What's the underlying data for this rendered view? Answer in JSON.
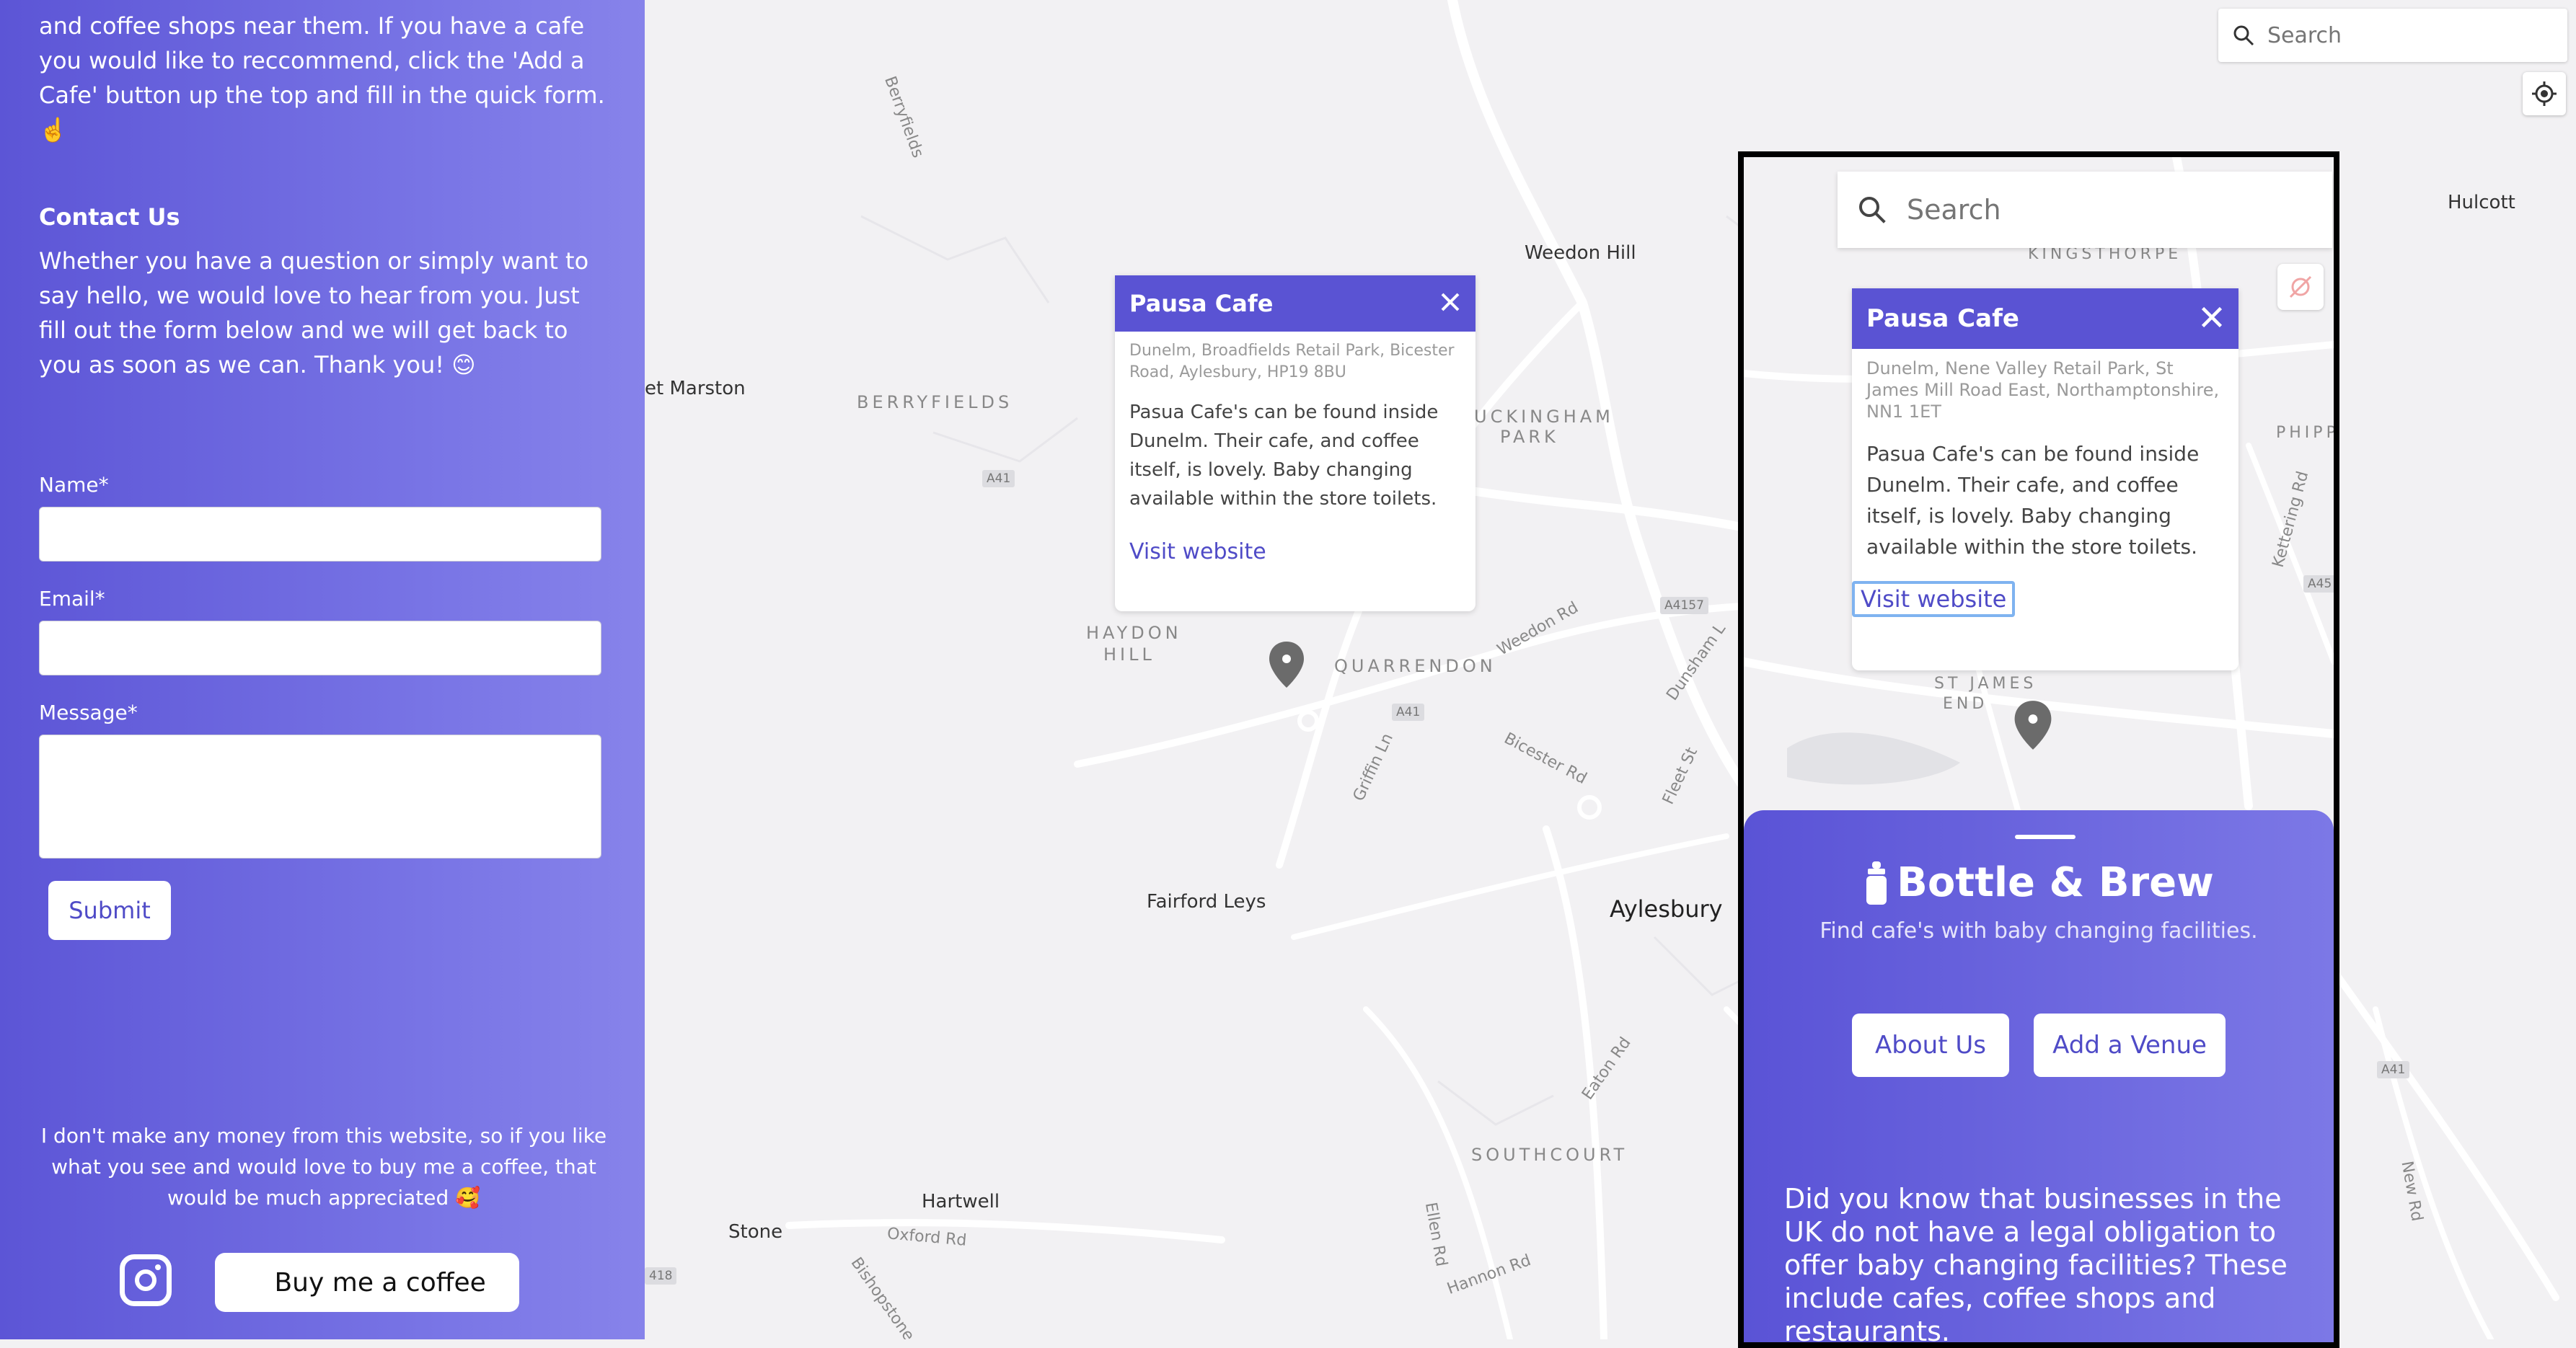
{
  "sidebar": {
    "intro_text": "and coffee shops near them. If you have a cafe you would like to reccommend, click the 'Add a Cafe' button up the top and fill in the quick form. ☝️",
    "contact_heading": "Contact Us",
    "contact_text": "Whether you have a question or simply want to say hello, we would love to hear from you. Just fill out the form below and we will get back to you as soon as we can. Thank you! 😊",
    "form": {
      "name_label": "Name*",
      "name_value": "",
      "email_label": "Email*",
      "email_value": "",
      "message_label": "Message*",
      "message_value": "",
      "submit_label": "Submit"
    },
    "support_text": "I don't make any money from this website, so if you like what you see and would love to buy me a coffee, that would be much appreciated 🥰",
    "instagram_icon": "instagram-icon",
    "coffee_button": {
      "icon": "☕",
      "label": "Buy me a coffee"
    }
  },
  "map": {
    "search_placeholder": "Search",
    "labels": {
      "weedon_hill": "Weedon Hill",
      "hulcott": "Hulcott",
      "marston": "et Marston",
      "berryfields": "BERRYFIELDS",
      "buckingham_park_1": "UCKINGHAM",
      "buckingham_park_2": "PARK",
      "haydon_hill_1": "HAYDON",
      "haydon_hill_2": "HILL",
      "quarrendon": "QUARRENDON",
      "fairford_leys": "Fairford Leys",
      "aylesbury": "Aylesbury",
      "southcourt": "SOUTHCOURT",
      "hartwell": "Hartwell",
      "stone": "Stone",
      "oxford_rd": "Oxford Rd",
      "weedon_rd": "Weedon Rd",
      "bicester_rd": "Bicester Rd",
      "griffin_ln": "Griffin Ln",
      "eaton_rd": "Eaton Rd",
      "ellen_rd": "Ellen Rd",
      "hannon_rd": "Hannon Rd",
      "berryfields_rd": "Berryfields",
      "new_rd": "New Rd",
      "dunsham_ln": "Dunsham L",
      "fleet_st": "Fleet St",
      "bishopstone": "Bishopstone",
      "a41_1": "A41",
      "a41_2": "A41",
      "a41_3": "A41",
      "a4157": "A4157",
      "a418": "418"
    },
    "popup": {
      "title": "Pausa Cafe",
      "address": "Dunelm, Broadfields Retail Park, Bicester Road, Aylesbury, HP19 8BU",
      "description": "Pasua Cafe's can be found inside Dunelm. Their cafe, and coffee itself, is lovely. Baby changing available within the store toilets.",
      "link": "Visit website"
    }
  },
  "mobile": {
    "search_placeholder": "Search",
    "labels": {
      "kingsthorpe": "KINGSTHORPE",
      "phipps": "PHIPPS",
      "st_james_1": "ST JAMES",
      "st_james_2": "END",
      "kettering_rd": "Kettering Rd",
      "a45": "A45"
    },
    "popup": {
      "title": "Pausa Cafe",
      "address": "Dunelm, Nene Valley Retail Park, St James Mill Road East, Northamptonshire, NN1 1ET",
      "description": "Pasua Cafe's can be found inside Dunelm. Their cafe, and coffee itself, is lovely. Baby changing available within the store toilets.",
      "link": "Visit website"
    },
    "brand": "Bottle & Brew",
    "tagline": "Find cafe's with baby changing facilities.",
    "about_button": "About Us",
    "add_venue_button": "Add a Venue",
    "fact": "Did you know that businesses in the UK do not have a legal obligation to offer baby changing facilities? These include cafes, coffee shops and restaurants."
  },
  "colors": {
    "accent": "#5a53d3",
    "sidebar_gradient_start": "#5c55d6",
    "sidebar_gradient_end": "#8783ea",
    "map_bg": "#f2f1f3"
  }
}
